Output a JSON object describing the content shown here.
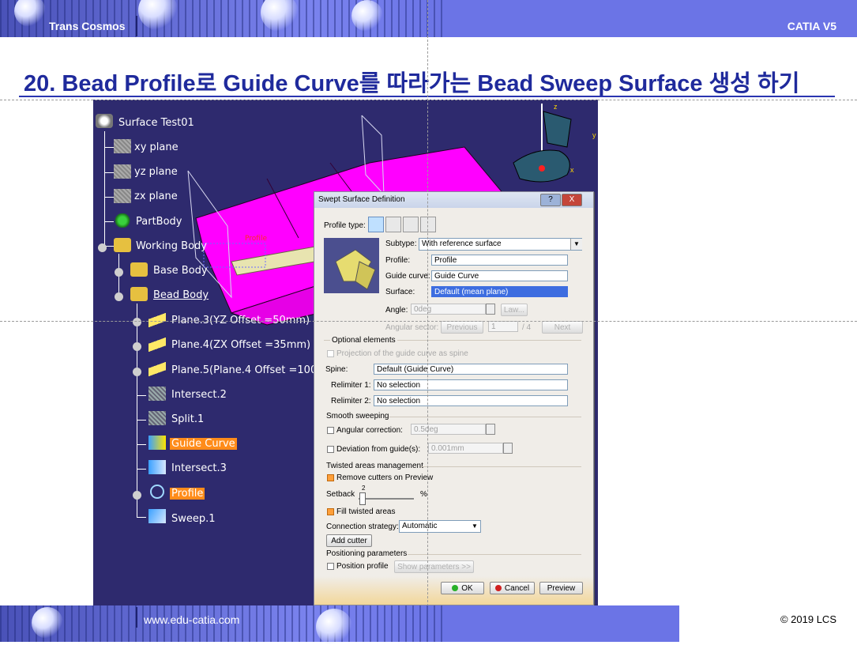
{
  "header": {
    "brand": "Trans Cosmos",
    "product": "CATIA V5"
  },
  "slide_title": "20. Bead Profile로 Guide Curve를 따라가는 Bead Sweep Surface 생성 하기",
  "footer": {
    "site": "www.edu-catia.com",
    "copyright": "© 2019 LCS"
  },
  "tree": {
    "root": "Surface Test01",
    "items": [
      {
        "label": "xy plane"
      },
      {
        "label": "yz plane"
      },
      {
        "label": "zx plane"
      },
      {
        "label": "PartBody"
      },
      {
        "label": "Working Body"
      },
      {
        "label": "Base Body"
      },
      {
        "label": "Bead Body"
      },
      {
        "label": "Plane.3(YZ Offset  =50mm)"
      },
      {
        "label": "Plane.4(ZX Offset  =35mm)"
      },
      {
        "label": "Plane.5(Plane.4 Offset  =100mm"
      },
      {
        "label": "Intersect.2"
      },
      {
        "label": "Split.1"
      },
      {
        "label": "Guide Curve"
      },
      {
        "label": "Intersect.3"
      },
      {
        "label": "Profile"
      },
      {
        "label": "Sweep.1"
      }
    ]
  },
  "viewport_labels": {
    "profile_tag": "Profile",
    "axis_z": "z",
    "axis_y": "y",
    "axis_x": "x"
  },
  "dialog": {
    "title": "Swept Surface Definition",
    "help_btn": "?",
    "close_btn": "X",
    "profile_type_label": "Profile type:",
    "subtype_label": "Subtype:",
    "subtype_value": "With reference surface",
    "profile_label": "Profile:",
    "profile_value": "Profile",
    "guide_label": "Guide curve:",
    "guide_value": "Guide Curve",
    "surface_label": "Surface:",
    "surface_value": "Default (mean plane)",
    "angle_label": "Angle:",
    "angle_value": "0deg",
    "law_btn": "Law...",
    "angular_sector_label": "Angular sector:",
    "previous_btn": "Previous",
    "sector_value": "1",
    "sector_total": "/ 4",
    "next_btn": "Next",
    "optional_elements": "Optional elements",
    "projection_label": "Projection of the guide curve as spine",
    "spine_label": "Spine:",
    "spine_value": "Default (Guide Curve)",
    "relimiter1_label": "Relimiter 1:",
    "relimiter1_value": "No selection",
    "relimiter2_label": "Relimiter 2:",
    "relimiter2_value": "No selection",
    "smooth_sweeping": "Smooth sweeping",
    "angular_correction_label": "Angular correction:",
    "angular_correction_value": "0.5deg",
    "deviation_label": "Deviation from guide(s):",
    "deviation_value": "0.001mm",
    "twisted_areas": "Twisted areas management",
    "remove_cutters_label": "Remove cutters on Preview",
    "setback_label": "Setback",
    "setback_value": "2",
    "setback_unit": "%",
    "fill_twisted_label": "Fill twisted areas",
    "connection_label": "Connection strategy:",
    "connection_value": "Automatic",
    "add_cutter_btn": "Add cutter",
    "positioning_params": "Positioning parameters",
    "position_profile_label": "Position profile",
    "show_params_btn": "Show parameters >>",
    "ok_btn": "OK",
    "cancel_btn": "Cancel",
    "preview_btn": "Preview"
  }
}
